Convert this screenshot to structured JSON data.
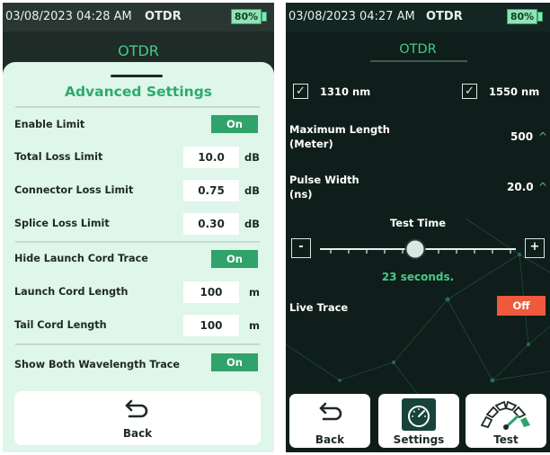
{
  "left": {
    "status": {
      "datetime": "03/08/2023 04:28 AM",
      "app": "OTDR",
      "battery": "80%"
    },
    "title": "OTDR",
    "panel_title": "Advanced Settings",
    "rows": {
      "enable_limit": {
        "label": "Enable Limit",
        "toggle": "On"
      },
      "total_loss": {
        "label": "Total Loss Limit",
        "value": "10.0",
        "unit": "dB"
      },
      "connector_loss": {
        "label": "Connector Loss Limit",
        "value": "0.75",
        "unit": "dB"
      },
      "splice_loss": {
        "label": "Splice Loss Limit",
        "value": "0.30",
        "unit": "dB"
      },
      "hide_launch": {
        "label": "Hide Launch Cord Trace",
        "toggle": "On"
      },
      "launch_length": {
        "label": "Launch Cord Length",
        "value": "100",
        "unit": "m"
      },
      "tail_length": {
        "label": "Tail Cord Length",
        "value": "100",
        "unit": "m"
      },
      "show_both": {
        "label": "Show Both Wavelength Trace",
        "toggle": "On"
      }
    },
    "back_label": "Back",
    "icons": {
      "back": "back-arrow-icon"
    }
  },
  "right": {
    "status": {
      "datetime": "03/08/2023 04:27 AM",
      "app": "OTDR",
      "battery": "80%"
    },
    "title": "OTDR",
    "wavelengths": [
      {
        "label": "1310 nm",
        "checked": true
      },
      {
        "label": "1550 nm",
        "checked": true
      }
    ],
    "checkmark": "✓",
    "max_length": {
      "label_line1": "Maximum Length",
      "label_line2": "(Meter)",
      "value": "500"
    },
    "pulse_width": {
      "label_line1": "Pulse Width",
      "label_line2": "(ns)",
      "value": "20.0"
    },
    "caret": "^",
    "test_time": {
      "label": "Test Time",
      "minus": "-",
      "plus": "+",
      "readout": "23 seconds."
    },
    "live_trace": {
      "label": "Live Trace",
      "toggle": "Off"
    },
    "nav": {
      "back": "Back",
      "settings": "Settings",
      "test": "Test"
    },
    "icons": {
      "back": "back-arrow-icon",
      "settings": "speedometer-icon",
      "test": "gauge-icon"
    }
  },
  "colors": {
    "accent": "#2fa36a",
    "accent_text": "#46c98a",
    "off": "#f05a3c",
    "panel": "#dff6ea",
    "dark_bg": "#0f1e1a"
  }
}
